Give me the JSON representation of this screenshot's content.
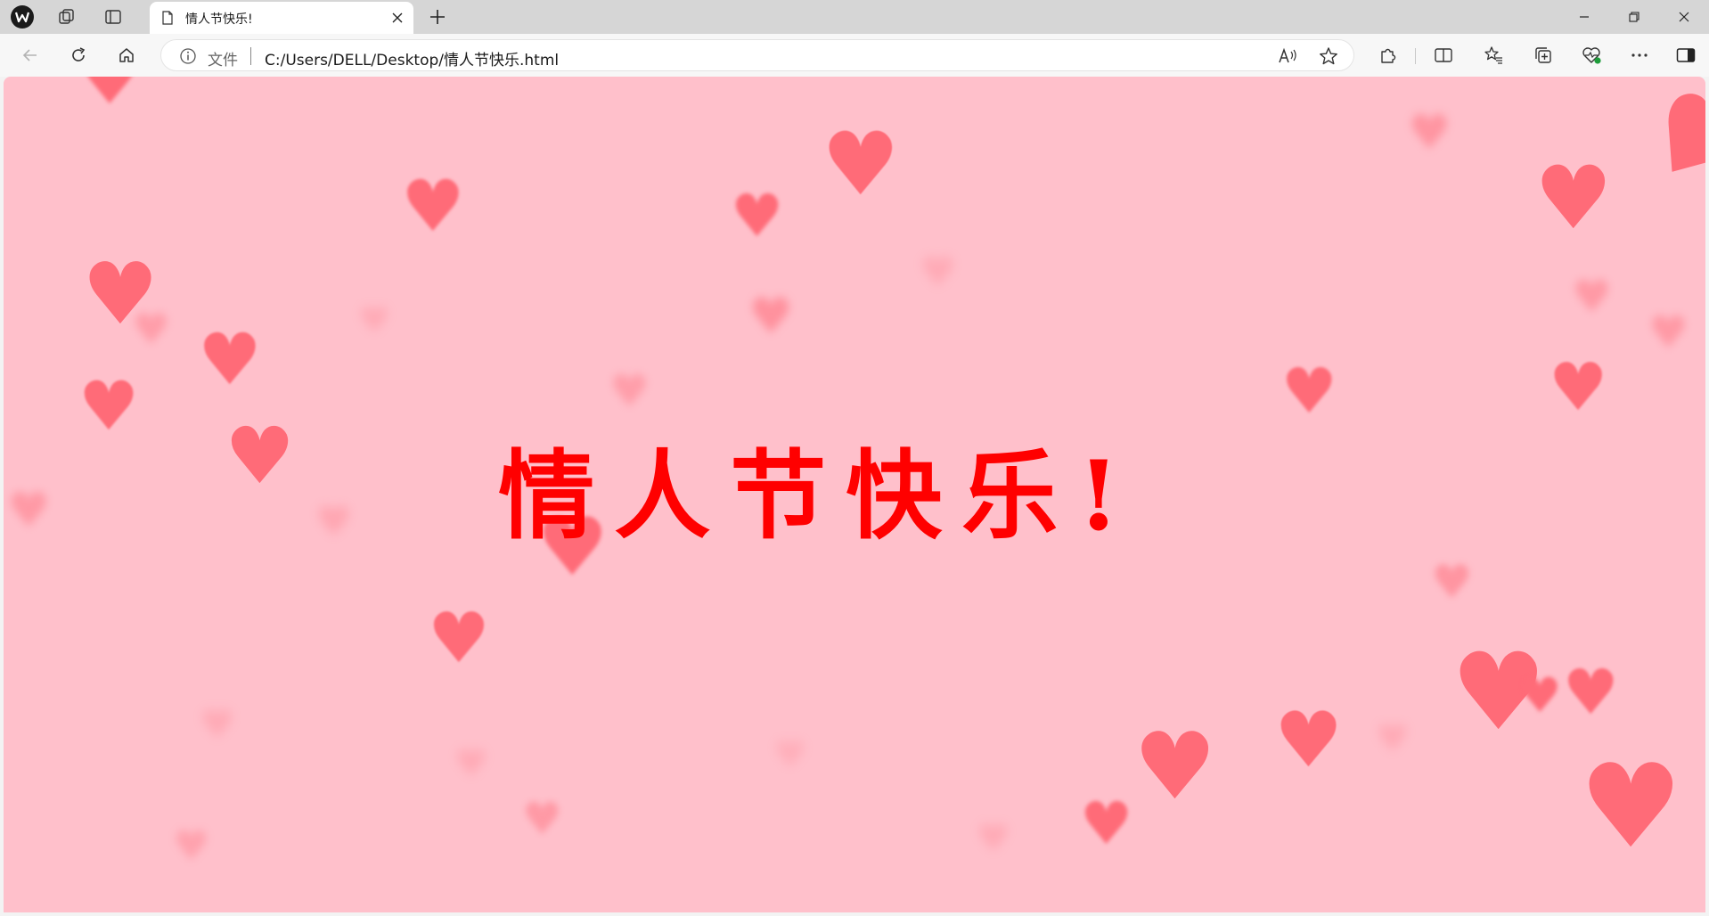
{
  "tab": {
    "title": "情人节快乐!"
  },
  "toolbar": {
    "address_label": "文件",
    "url": "C:/Users/DELL/Desktop/情人节快乐.html"
  },
  "page": {
    "title": "情人节快乐!",
    "background_color": "#ffc0cb",
    "title_color": "#ff0000",
    "heart_color": "#ff6b78"
  },
  "icons": {
    "tab_bar": [
      "browser-profile-icon",
      "workspaces-icon",
      "tab-actions-icon",
      "page-icon",
      "close-icon",
      "new-tab-icon"
    ],
    "window": [
      "minimize-icon",
      "restore-icon",
      "close-window-icon"
    ],
    "toolbar": [
      "back-icon",
      "refresh-icon",
      "home-icon",
      "info-icon",
      "read-aloud-icon",
      "favorite-star-icon",
      "extensions-icon",
      "split-screen-icon",
      "favorites-icon",
      "collections-icon",
      "browser-essentials-icon",
      "more-icon",
      "sidebar-icon"
    ]
  }
}
